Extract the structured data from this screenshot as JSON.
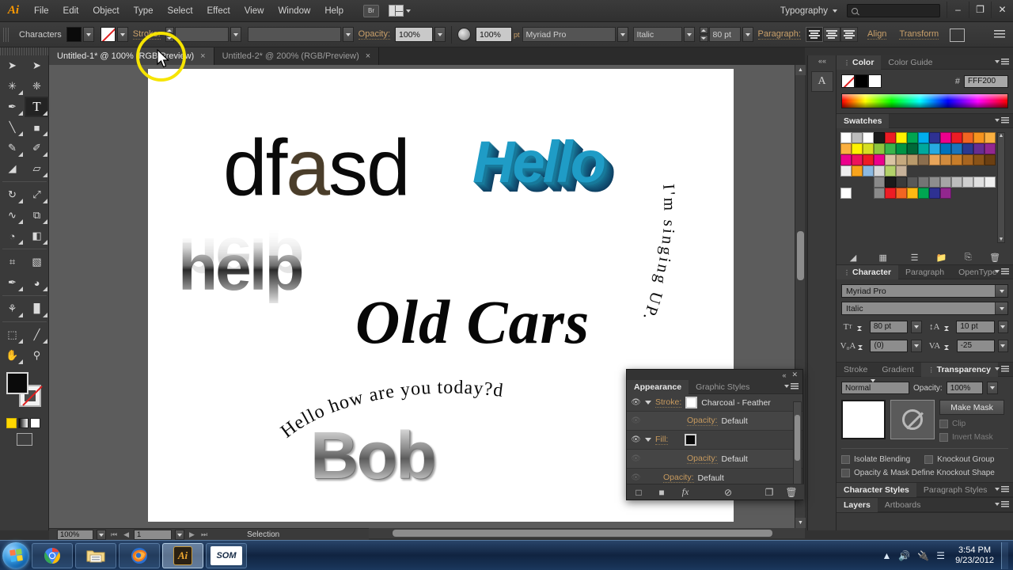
{
  "app": {
    "name": "Adobe Illustrator",
    "logo_text": "Ai"
  },
  "menubar": {
    "items": [
      "File",
      "Edit",
      "Object",
      "Type",
      "Select",
      "Effect",
      "View",
      "Window",
      "Help"
    ],
    "bridge_label": "Br",
    "workspace_label": "Typography",
    "search_placeholder": "",
    "minimize": "–",
    "restore": "❐",
    "close": "✕"
  },
  "control_bar": {
    "panel_label": "Characters",
    "fill_swatch": "black-fill",
    "stroke_swatch": "none-stroke",
    "stroke_label": "Stroke:",
    "stroke_weight": "",
    "stroke_profile": "",
    "opacity_label": "Opacity:",
    "opacity_value": "100%",
    "zoom_value": "100%",
    "zoom_suffix": "pt",
    "font_family": "Myriad Pro",
    "font_style": "Italic",
    "font_size": "80 pt",
    "paragraph_label": "Paragraph:",
    "align_left": "align-left",
    "align_center": "align-center",
    "align_right": "align-right",
    "align_link": "Align",
    "transform_link": "Transform"
  },
  "doc_tabs": [
    {
      "label": "Untitled-1* @ 100% (RGB/Preview)",
      "active": true,
      "close": "×"
    },
    {
      "label": "Untitled-2* @ 200% (RGB/Preview)",
      "active": false,
      "close": "×"
    }
  ],
  "toolbar": {
    "tools": [
      {
        "name": "selection-tool",
        "glyph": "➤"
      },
      {
        "name": "direct-selection-tool",
        "glyph": "➤"
      },
      {
        "name": "magic-wand-tool",
        "glyph": "✳"
      },
      {
        "name": "lasso-tool",
        "glyph": "❈"
      },
      {
        "name": "pen-tool",
        "glyph": "✒"
      },
      {
        "name": "type-tool",
        "glyph": "T",
        "selected": true
      },
      {
        "name": "line-segment-tool",
        "glyph": "╲"
      },
      {
        "name": "rectangle-tool",
        "glyph": "■"
      },
      {
        "name": "paintbrush-tool",
        "glyph": "✎"
      },
      {
        "name": "pencil-tool",
        "glyph": "✐"
      },
      {
        "name": "blob-brush-tool",
        "glyph": "◢"
      },
      {
        "name": "eraser-tool",
        "glyph": "▱"
      },
      {
        "name": "rotate-tool",
        "glyph": "↻"
      },
      {
        "name": "scale-tool",
        "glyph": "⤢"
      },
      {
        "name": "width-tool",
        "glyph": "∿"
      },
      {
        "name": "free-transform-tool",
        "glyph": "⧉"
      },
      {
        "name": "shape-builder-tool",
        "glyph": "◔"
      },
      {
        "name": "perspective-grid-tool",
        "glyph": "◧"
      },
      {
        "name": "mesh-tool",
        "glyph": "⌗"
      },
      {
        "name": "gradient-tool",
        "glyph": "▧"
      },
      {
        "name": "eyedropper-tool",
        "glyph": "✒"
      },
      {
        "name": "blend-tool",
        "glyph": "◕"
      },
      {
        "name": "symbol-sprayer-tool",
        "glyph": "⚘"
      },
      {
        "name": "column-graph-tool",
        "glyph": "█"
      },
      {
        "name": "artboard-tool",
        "glyph": "⬚"
      },
      {
        "name": "slice-tool",
        "glyph": "╱"
      },
      {
        "name": "hand-tool",
        "glyph": "✋"
      },
      {
        "name": "zoom-tool",
        "glyph": "⚲"
      }
    ]
  },
  "artwork": {
    "dfasd": {
      "prefix": "df",
      "textured": "a",
      "suffix": "sd"
    },
    "hello_3d": "Hello",
    "help_chrome": "help",
    "old_cars": "Old Cars",
    "bob": "Bob",
    "curve_singing": "I'm singing UP.",
    "curve_question": "Hello how are you today?d"
  },
  "status_bar": {
    "zoom": "100%",
    "artboard_number": "1",
    "status_text": "Selection",
    "first_glyph": "⏮",
    "prev_glyph": "◀",
    "next_glyph": "▶",
    "last_glyph": "⏭"
  },
  "panels": {
    "color": {
      "tabs": [
        "Color",
        "Color Guide"
      ],
      "active_tab": "Color",
      "hash_label": "#",
      "hex_value": "FFF200",
      "swatches": [
        "none",
        "black",
        "white"
      ]
    },
    "swatches": {
      "title": "Swatches",
      "rows": [
        [
          "#ffffff",
          "#bdbdbd",
          "#ffffff",
          "#1a1a1a",
          "#ed1c24",
          "#fff200",
          "#00a651",
          "#00aeef",
          "#2e3192",
          "#ec008c",
          "#ed1c24",
          "#f26522",
          "#f7941e",
          "#fbb040",
          "#fbb040"
        ],
        [
          "#fff200",
          "#d7df23",
          "#8dc63f",
          "#39b54a",
          "#009444",
          "#006838",
          "#00a99d",
          "#27aae1",
          "#0072bc",
          "#1b75bb",
          "#2b3990",
          "#662d91",
          "#92278f",
          "#ec008c",
          "#ed145b"
        ],
        [
          "#ed1c24",
          "#ec008c",
          "#d9c4a3",
          "#c6a97e",
          "#b99a6b",
          "#8b6e4e",
          "#e8a55a",
          "#d18b3e",
          "#c87d2a",
          "#a86520",
          "#8a5318",
          "#6b3f12",
          "#eeeeee",
          "#f7a41d",
          "#8cb9e0"
        ],
        [
          "#d9d9d9",
          "#b3d16a",
          "#c7b29a"
        ],
        [
          "#8a8a8a",
          "#1a1a1a",
          "#3a3a3a",
          "#585858",
          "#747474",
          "#8e8e8e",
          "#a6a6a6",
          "#bdbdbd",
          "#d0d0d0",
          "#e0e0e0",
          "#efefef",
          "#ffffff"
        ],
        [
          "#8a8a8a",
          "#ed1c24",
          "#f26522",
          "#fdb913",
          "#00a651",
          "#2e3192",
          "#92278f"
        ]
      ],
      "footer_icons": [
        "libraries-icon",
        "show-swatch-kinds-icon",
        "swatch-options-icon",
        "new-group-icon",
        "new-swatch-icon",
        "delete-swatch-icon"
      ]
    },
    "character": {
      "tabs": [
        "Character",
        "Paragraph",
        "OpenType"
      ],
      "active_tab": "Character",
      "font_family": "Myriad Pro",
      "font_style": "Italic",
      "font_size": "80 pt",
      "leading": "10 pt",
      "kerning": "(0)",
      "tracking": "-25",
      "size_icon": "font-size-icon",
      "leading_icon": "leading-icon",
      "kerning_icon": "kerning-icon",
      "tracking_icon": "tracking-icon"
    },
    "transparency": {
      "tabs": [
        "Stroke",
        "Gradient",
        "Transparency"
      ],
      "active_tab": "Transparency",
      "blend_mode": "Normal",
      "opacity_label": "Opacity:",
      "opacity_value": "100%",
      "make_mask": "Make Mask",
      "clip": "Clip",
      "invert_mask": "Invert Mask",
      "isolate_blending": "Isolate Blending",
      "knockout_group": "Knockout Group",
      "define_knockout": "Opacity & Mask Define Knockout Shape"
    },
    "styles": {
      "tabs": [
        "Character Styles",
        "Paragraph Styles"
      ],
      "active_tab": "Character Styles"
    },
    "layers": {
      "tabs": [
        "Layers",
        "Artboards"
      ],
      "active_tab": "Layers"
    }
  },
  "appearance_panel": {
    "tabs": [
      "Appearance",
      "Graphic Styles"
    ],
    "active_tab": "Appearance",
    "collapse_glyph": "«",
    "close_glyph": "✕",
    "rows": [
      {
        "label": "Stroke:",
        "value": "Charcoal - Feather",
        "type": "stroke",
        "eye": true
      },
      {
        "label": "Opacity:",
        "value": "Default",
        "type": "opacity",
        "eye": false
      },
      {
        "label": "Fill:",
        "value": "",
        "type": "fill",
        "eye": true
      },
      {
        "label": "Opacity:",
        "value": "Default",
        "type": "opacity",
        "eye": false
      },
      {
        "label": "Opacity:",
        "value": "Default",
        "type": "opacity",
        "eye": false
      }
    ],
    "footer_icons": [
      "add-new-stroke-icon",
      "add-new-fill-icon",
      "add-new-effect-icon",
      "clear-appearance-icon",
      "duplicate-item-icon",
      "delete-item-icon"
    ],
    "fx_label": "fx"
  },
  "taskbar": {
    "start": "start-orb",
    "items": [
      {
        "name": "chrome",
        "label": "Google Chrome"
      },
      {
        "name": "explorer",
        "label": "Windows Explorer"
      },
      {
        "name": "firefox",
        "label": "Mozilla Firefox"
      },
      {
        "name": "illustrator",
        "label": "Ai"
      },
      {
        "name": "som",
        "label": "SOM"
      }
    ],
    "tray": {
      "show_hidden": "▲",
      "volume": "volume-icon",
      "battery": "battery-icon",
      "network": "network-icon",
      "time": "3:54 PM",
      "date": "9/23/2012"
    }
  }
}
